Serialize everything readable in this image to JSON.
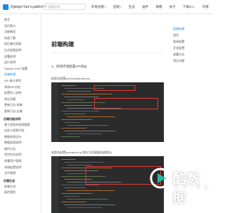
{
  "header": {
    "brand": "Django-Vue-Lyadmin",
    "search_placeholder": "搜索文档",
    "nav": [
      {
        "label": "开发指南",
        "dropdown": true
      },
      {
        "label": "后端",
        "dropdown": true
      },
      {
        "label": "生态",
        "dropdown": false
      },
      {
        "label": "插件",
        "dropdown": false
      },
      {
        "label": "捐赠",
        "dropdown": false
      },
      {
        "label": "关于",
        "dropdown": false
      },
      {
        "label": "下载/CI",
        "dropdown": true
      },
      {
        "label": "作者",
        "dropdown": false
      }
    ]
  },
  "sidebar": {
    "items": [
      {
        "label": "前言",
        "active": false
      },
      {
        "label": "项目简介",
        "active": false
      },
      {
        "label": "功能概览",
        "active": false
      },
      {
        "label": "快速了解",
        "active": false
      },
      {
        "label": "前后端分离版",
        "active": false
      },
      {
        "label": "后台权限说明",
        "active": false
      },
      {
        "label": "部署说明",
        "active": false
      },
      {
        "label": "运行说明",
        "active": false
      },
      {
        "label": "Django-Vue3 部署",
        "active": false
      },
      {
        "label": "前端构建",
        "active": true
      },
      {
        "label": "API 接口说明",
        "active": false
      },
      {
        "label": "系统API文档",
        "active": false
      },
      {
        "label": "配置导入说明",
        "active": false
      },
      {
        "label": "常见问题",
        "active": false
      },
      {
        "label": "更新日志-前端",
        "active": false
      },
      {
        "label": "更新日志-后端",
        "active": false
      }
    ],
    "group1": {
      "title": "后端功能说明",
      "items": [
        "基于角色的权限管理",
        "自定义权限字段",
        "数据库表设计",
        "数据权限说明",
        "操作日志",
        "定时任务说明",
        "部署用户管理",
        "系统配置说明",
        "文件管理"
      ]
    },
    "group2": {
      "title": "后端生态",
      "items": [
        "前端生态",
        "插件模型"
      ]
    }
  },
  "main": {
    "title": "前端构建",
    "list_item": "1、修改环境配置API地址",
    "caption1": "新版本配置(src/config/index.js)",
    "caption2": "老版本配置(src/api/url.js 地址为后端服务器地址)"
  },
  "toc": {
    "items": [
      {
        "label": "前端构建",
        "active": true
      },
      {
        "label": "首页",
        "active": false
      },
      {
        "label": "简单配置",
        "active": false
      },
      {
        "label": "开发配置",
        "active": false
      },
      {
        "label": "部署方式",
        "active": false
      },
      {
        "label": "常见问题",
        "active": false
      }
    ]
  },
  "watermark": {
    "text": "酷数据",
    "sub": "KUIDC"
  },
  "colors": {
    "accent": "#1e88e5",
    "ide_bg": "#2b2b2b",
    "highlight": "#e53935"
  }
}
